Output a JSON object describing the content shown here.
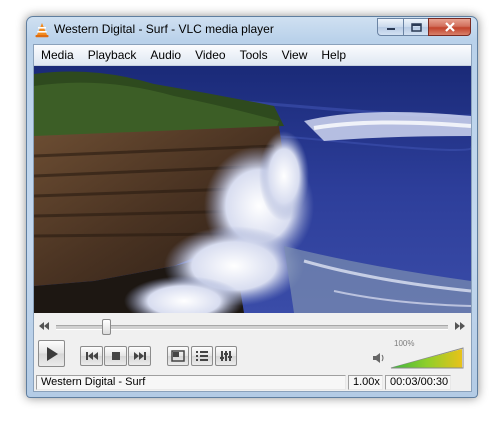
{
  "window": {
    "title": "Western Digital - Surf - VLC media player",
    "app_icon": "vlc-cone-icon"
  },
  "menu": [
    "Media",
    "Playback",
    "Audio",
    "Video",
    "Tools",
    "View",
    "Help"
  ],
  "seek": {
    "position_fraction": 0.13
  },
  "controls": {
    "play_icon": "play-icon",
    "prev_icon": "previous-icon",
    "stop_icon": "stop-icon",
    "next_icon": "next-icon",
    "fullscreen_icon": "fullscreen-icon",
    "playlist_icon": "playlist-icon",
    "extended_icon": "extended-settings-icon"
  },
  "volume": {
    "label": "100%",
    "level": 1.0,
    "icon": "speaker-icon"
  },
  "status": {
    "media_name": "Western Digital - Surf",
    "speed": "1.00x",
    "time": "00:03/00:30"
  },
  "colors": {
    "accent_orange": "#f08a1c",
    "close_red": "#c2432c"
  }
}
